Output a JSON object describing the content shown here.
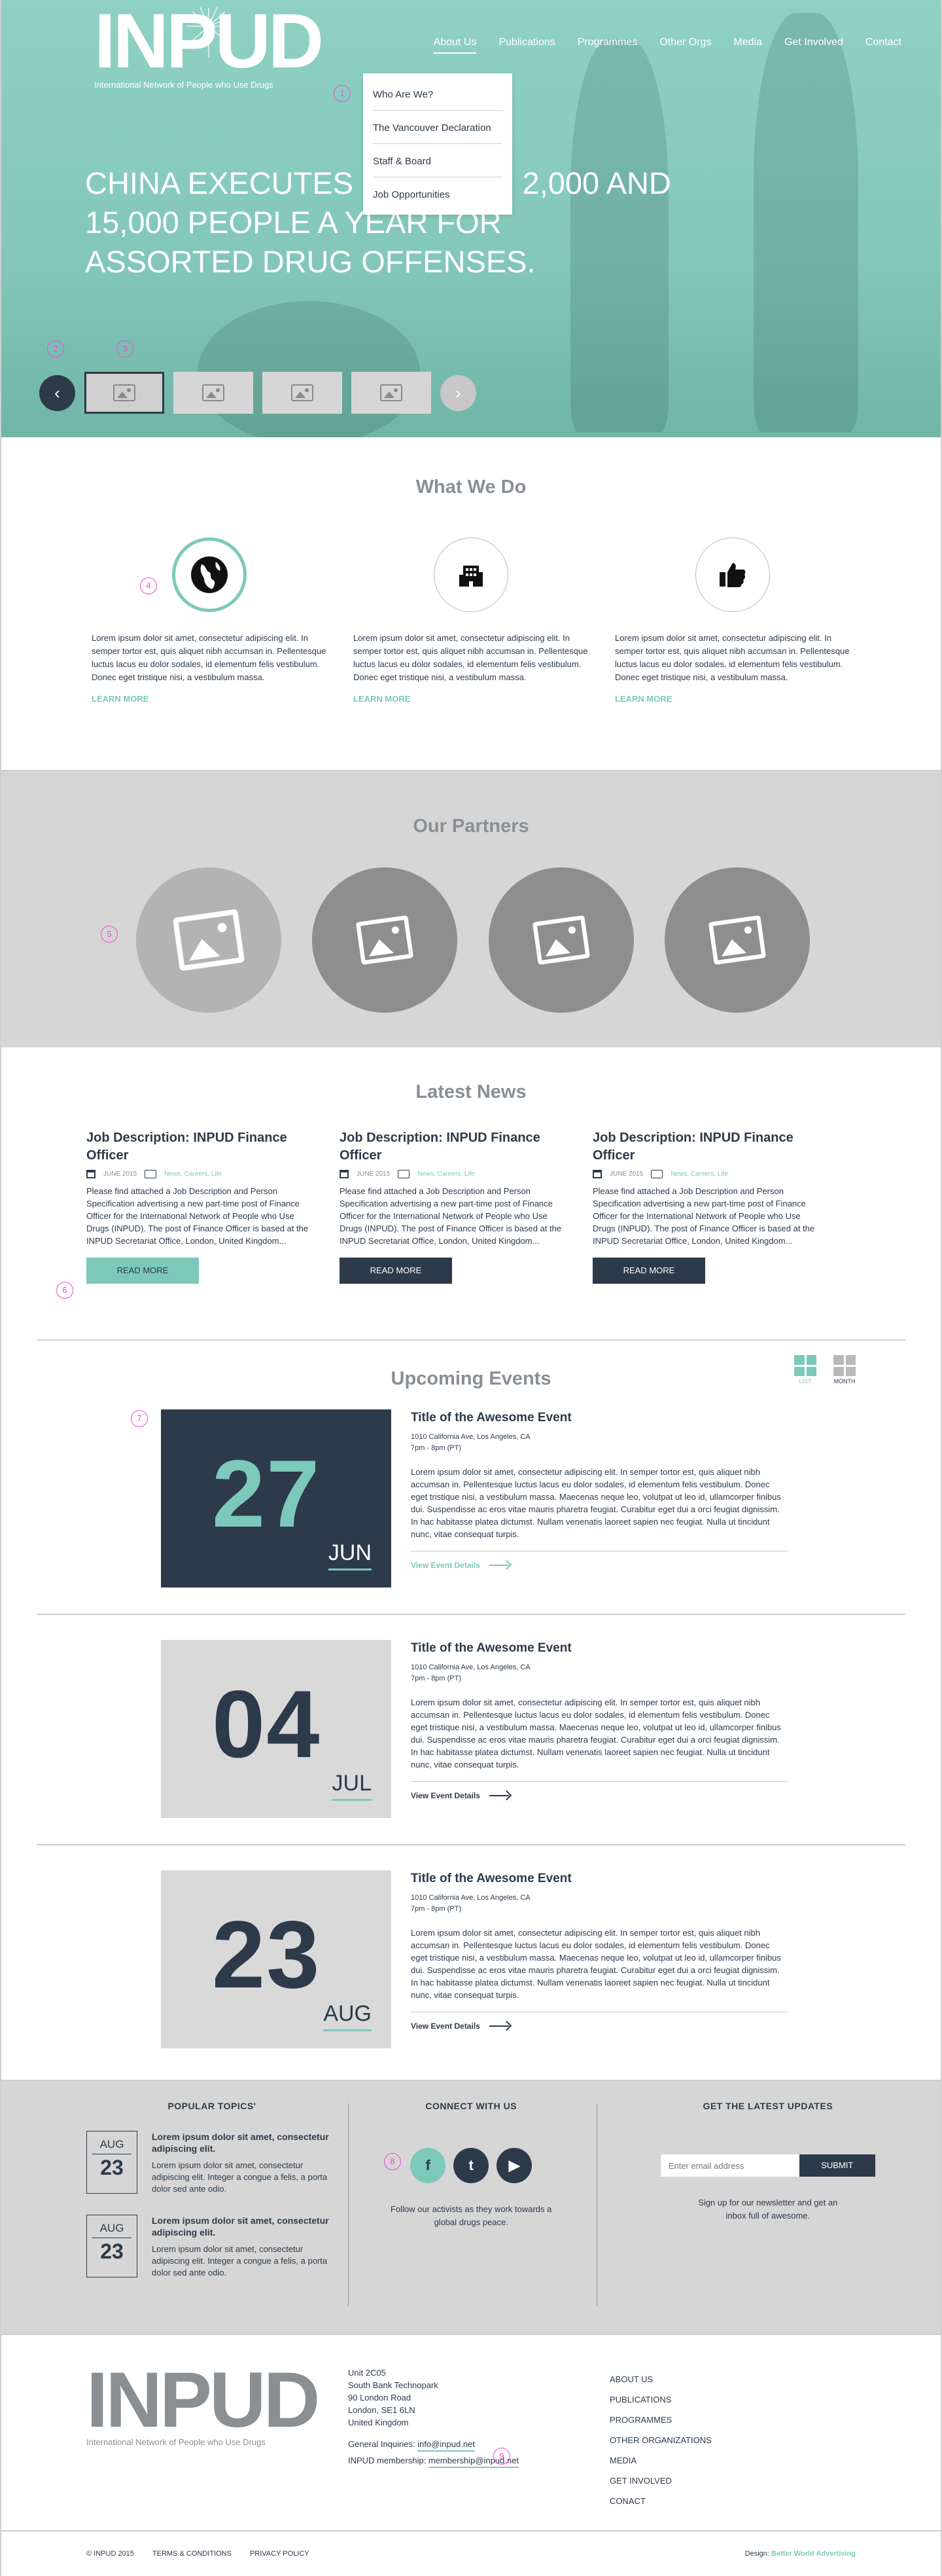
{
  "brand": {
    "logo": "INPUD",
    "tagline": "International Network of People who Use Drugs"
  },
  "nav": {
    "items": [
      "About Us",
      "Publications",
      "Programmes",
      "Other Orgs",
      "Media",
      "Get Involved",
      "Contact"
    ],
    "dropdown": [
      "Who Are We?",
      "The Vancouver Declaration",
      "Staff & Board",
      "Job Opportunities"
    ]
  },
  "markers": [
    "1",
    "2",
    "3",
    "4",
    "5",
    "6",
    "7",
    "8",
    "9"
  ],
  "hero": {
    "headline": "CHINA EXECUTES BETWEEN 2,000 AND 15,000 PEOPLE A YEAR FOR ASSORTED DRUG OFFENSES.",
    "prev_icon": "chevron-left-icon",
    "next_icon": "chevron-right-icon"
  },
  "what_we_do": {
    "title": "What We Do",
    "items": [
      {
        "icon": "globe-icon",
        "text": "Lorem ipsum dolor sit amet, consectetur adipiscing elit. In semper tortor est, quis aliquet nibh accumsan in. Pellentesque luctus lacus eu dolor sodales, id elementum felis vestibulum. Donec eget tristique nisi, a vestibulum massa.",
        "link": "LEARN MORE"
      },
      {
        "icon": "building-icon",
        "text": "Lorem ipsum dolor sit amet, consectetur adipiscing elit. In semper tortor est, quis aliquet nibh accumsan in. Pellentesque luctus lacus eu dolor sodales, id elementum felis vestibulum. Donec eget tristique nisi, a vestibulum massa.",
        "link": "LEARN MORE"
      },
      {
        "icon": "thumbs-up-icon",
        "text": "Lorem ipsum dolor sit amet, consectetur adipiscing elit. In semper tortor est, quis aliquet nibh accumsan in. Pellentesque luctus lacus eu dolor sodales, id elementum felis vestibulum. Donec eget tristique nisi, a vestibulum massa.",
        "link": "LEARN MORE"
      }
    ]
  },
  "partners": {
    "title": "Our Partners"
  },
  "news": {
    "title": "Latest News",
    "items": [
      {
        "title": "Job Description: INPUD Finance Officer",
        "date": "JUNE 2015",
        "tags": "News, Careers, Life",
        "text": "Please find attached a Job Description and Person Specification advertising a new part-time post of Finance Officer for the International Network of People who Use Drugs (INPUD).  The post of Finance Officer is based at the INPUD Secretariat Office, London, United Kingdom...",
        "button": "READ MORE"
      },
      {
        "title": "Job Description: INPUD Finance Officer",
        "date": "JUNE 2015",
        "tags": "News, Careers, Life",
        "text": "Please find attached a Job Description and Person Specification advertising a new part-time post of Finance Officer for the International Network of People who Use Drugs (INPUD).  The post of Finance Officer is based at the INPUD Secretariat Office, London, United Kingdom...",
        "button": "READ MORE"
      },
      {
        "title": "Job Description: INPUD Finance Officer",
        "date": "JUNE 2015",
        "tags": "News, Careers, Life",
        "text": "Please find attached a Job Description and Person Specification advertising a new part-time post of Finance Officer for the International Network of People who Use Drugs (INPUD).  The post of Finance Officer is based at the INPUD Secretariat Office, London, United Kingdom...",
        "button": "READ MORE"
      }
    ]
  },
  "events": {
    "title": "Upcoming Events",
    "view_list": "LIST",
    "view_month": "MONTH",
    "items": [
      {
        "day": "27",
        "month": "JUN",
        "title": "Title of the Awesome Event",
        "address": "1010 California Ave, Los Angeles, CA",
        "time": "7pm - 8pm (PT)",
        "text": "Lorem ipsum dolor sit amet, consectetur adipiscing elit. In semper tortor est, quis aliquet nibh accumsan in. Pellentesque luctus lacus eu dolor sodales, id elementum felis vestibulum. Donec eget tristique nisi, a vestibulum massa. Maecenas neque leo, volutpat ut leo id, ullamcorper finibus dui. Suspendisse ac eros vitae mauris pharetra feugiat. Curabitur eget dui a orci feugiat dignissim. In hac habitasse platea dictumst. Nullam venenatis laoreet sapien nec feugiat. Nulla ut tincidunt nunc, vitae consequat turpis.",
        "link": "View Event Details"
      },
      {
        "day": "04",
        "month": "JUL",
        "title": "Title of the Awesome Event",
        "address": "1010 California Ave, Los Angeles, CA",
        "time": "7pm - 8pm (PT)",
        "text": "Lorem ipsum dolor sit amet, consectetur adipiscing elit. In semper tortor est, quis aliquet nibh accumsan in. Pellentesque luctus lacus eu dolor sodales, id elementum felis vestibulum. Donec eget tristique nisi, a vestibulum massa. Maecenas neque leo, volutpat ut leo id, ullamcorper finibus dui. Suspendisse ac eros vitae mauris pharetra feugiat. Curabitur eget dui a orci feugiat dignissim. In hac habitasse platea dictumst. Nullam venenatis laoreet sapien nec feugiat. Nulla ut tincidunt nunc, vitae consequat turpis.",
        "link": "View Event Details"
      },
      {
        "day": "23",
        "month": "AUG",
        "title": "Title of the Awesome Event",
        "address": "1010 California Ave, Los Angeles, CA",
        "time": "7pm - 8pm (PT)",
        "text": "Lorem ipsum dolor sit amet, consectetur adipiscing elit. In semper tortor est, quis aliquet nibh accumsan in. Pellentesque luctus lacus eu dolor sodales, id elementum felis vestibulum. Donec eget tristique nisi, a vestibulum massa. Maecenas neque leo, volutpat ut leo id, ullamcorper finibus dui. Suspendisse ac eros vitae mauris pharetra feugiat. Curabitur eget dui a orci feugiat dignissim. In hac habitasse platea dictumst. Nullam venenatis laoreet sapien nec feugiat. Nulla ut tincidunt nunc, vitae consequat turpis.",
        "link": "View Event Details"
      }
    ]
  },
  "footer_top": {
    "popular_title": "POPULAR TOPICS'",
    "topics": [
      {
        "month": "AUG",
        "day": "23",
        "title": "Lorem ipsum dolor sit amet, consectetur adipiscing elit.",
        "text": "Lorem ipsum dolor sit amet, consectetur adipiscing elit. Integer a congue a felis, a porta dolor sed ante odio."
      },
      {
        "month": "AUG",
        "day": "23",
        "title": "Lorem ipsum dolor sit amet, consectetur adipiscing elit.",
        "text": "Lorem ipsum dolor sit amet, consectetur adipiscing elit. Integer a congue a felis, a porta dolor sed ante odio."
      }
    ],
    "connect_title": "CONNECT WITH US",
    "social": [
      {
        "icon": "facebook-icon",
        "glyph": "f"
      },
      {
        "icon": "twitter-icon",
        "glyph": "t"
      },
      {
        "icon": "youtube-icon",
        "glyph": "▶"
      }
    ],
    "connect_text": "Follow our activists as they work towards a global drugs peace.",
    "updates_title": "GET THE LATEST UPDATES",
    "email_placeholder": "Enter email address",
    "submit": "SUBMIT",
    "updates_text": "Sign up for our newsletter and get an inbox full of awesome."
  },
  "footer_bottom": {
    "address": [
      "Unit 2C05",
      "South Bank Technopark",
      "90 London Road",
      "London, SE1 6LN",
      "United Kingdom"
    ],
    "general_label": "General Inquiries:",
    "general_email": "info@inpud.net",
    "membership_label": "INPUD membership:",
    "membership_email": "membership@inpud.net",
    "links": [
      "ABOUT US",
      "PUBLICATIONS",
      "PROGRAMMES",
      "OTHER ORGANIZATIONS",
      "MEDIA",
      "GET INVOLVED",
      "CONACT"
    ]
  },
  "legal": {
    "copyright": "© INPUD 2015",
    "terms": "TERMS & CONDITIONS",
    "privacy": "PRIVACY POLICY",
    "design_label": "Design:",
    "design_by": "Better World Advertising"
  }
}
